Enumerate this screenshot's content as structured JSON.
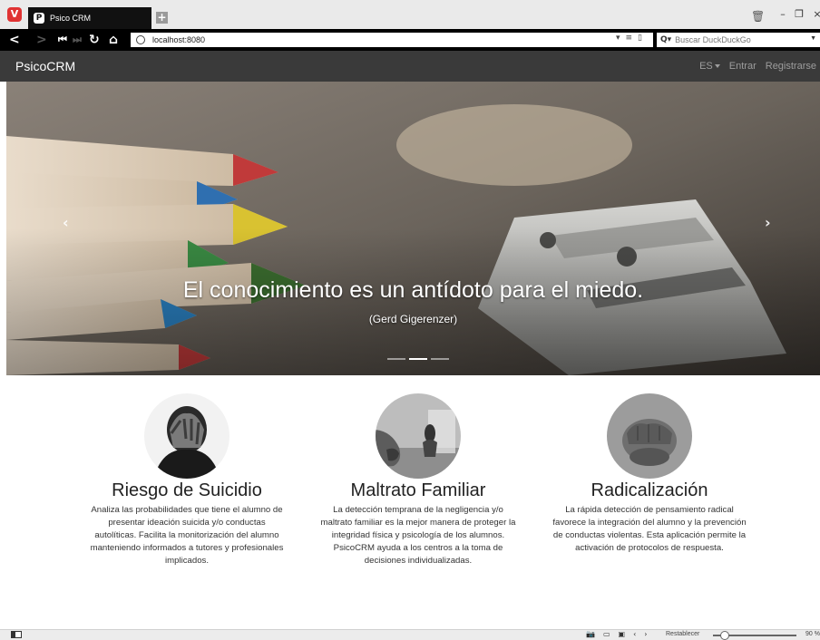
{
  "browser": {
    "tab_title": "Psico CRM",
    "tab_favicon_letter": "P",
    "url": "localhost:8080",
    "search_placeholder": "Buscar DuckDuckGo",
    "statusbar": {
      "reset_label": "Restablecer",
      "zoom": "90 %",
      "zoom_level": 0.1
    }
  },
  "navbar": {
    "brand": "PsicoCRM",
    "language": "ES",
    "login": "Entrar",
    "register": "Registrarse"
  },
  "carousel": {
    "quote": "El conocimiento es un antídoto para el miedo.",
    "author": "(Gerd Gigerenzer)",
    "slide_count": 3,
    "active_slide": 2
  },
  "features": [
    {
      "title": "Riesgo de Suicidio",
      "description": "Analiza las probabilidades que tiene el alumno de presentar ideación suicida y/o conductas autolíticas. Facilita la monitorización del alumno manteniendo informados a tutores y profesionales implicados."
    },
    {
      "title": "Maltrato Familiar",
      "description": "La detección temprana de la negligencia y/o maltrato familiar es la mejor manera de proteger la integridad física y psicología de los alumnos. PsicoCRM ayuda a los centros a la toma de decisiones individualizadas."
    },
    {
      "title": "Radicalización",
      "description": "La rápida detección de pensamiento radical favorece la integración del alumno y la prevención de conductas violentas. Esta aplicación permite la activación de protocolos de respuesta."
    }
  ]
}
